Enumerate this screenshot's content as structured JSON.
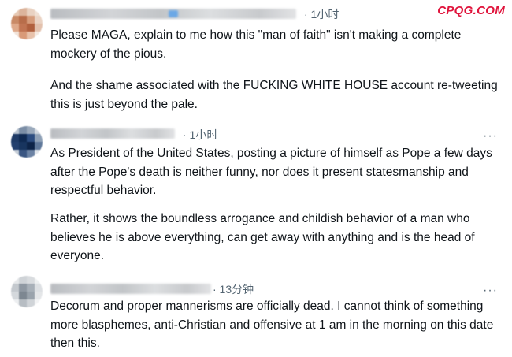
{
  "watermark": "CPQG.COM",
  "replies": [
    {
      "time": "· 1小时",
      "paragraphs": [
        "Please MAGA, explain to me how this \"man of faith\" isn't making a complete mockery of the pious.",
        "And the shame associated with the FUCKING WHITE HOUSE account re-tweeting this is just beyond the pale."
      ]
    },
    {
      "time": "· 1小时",
      "more_icon": "···",
      "paragraphs": [
        "As President of the United States, posting a picture of himself as Pope a few days after the Pope's death is neither funny, nor does it present statesmanship and respectful behavior.",
        "Rather, it shows the boundless arrogance and childish behavior of a man who believes he is above everything, can get away with anything and is the head of everyone."
      ]
    },
    {
      "time": "· 13分钟",
      "more_icon": "···",
      "paragraphs": [
        "Decorum and proper mannerisms are officially dead. I cannot think of something more blasphemes, anti-Christian and offensive at 1 am in the morning on this date then this."
      ]
    }
  ]
}
